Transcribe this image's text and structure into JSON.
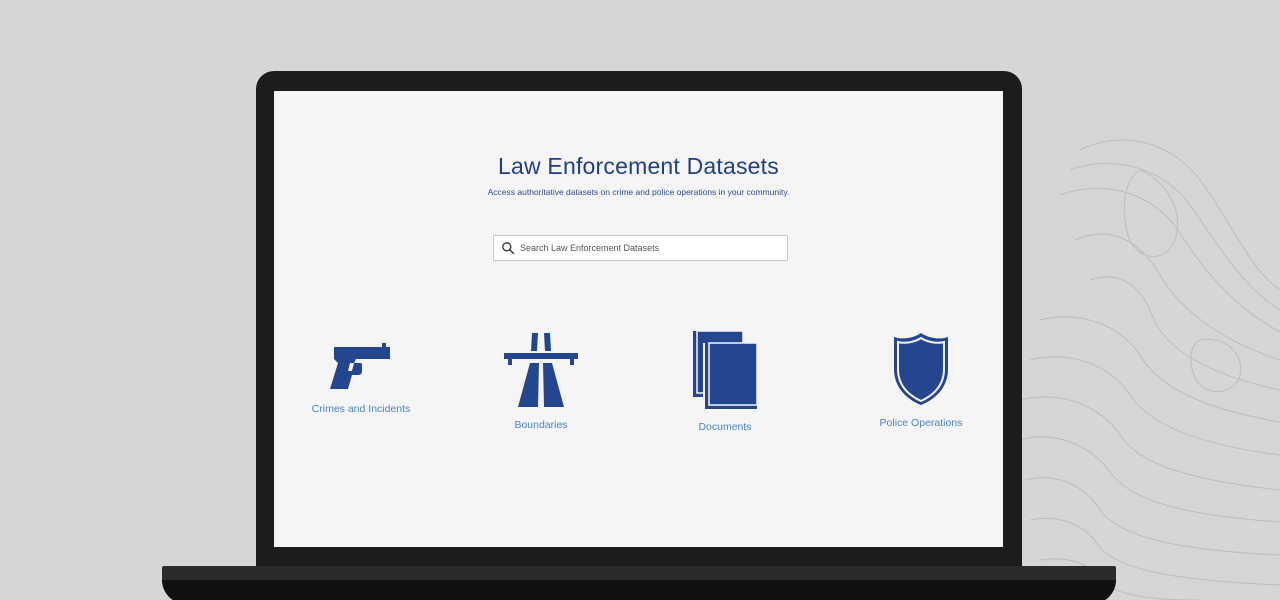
{
  "hub": {
    "title": "Law Enforcement Datasets",
    "subtitle": "Access authoritative datasets on crime and police operations in your community."
  },
  "search": {
    "placeholder": "Search Law Enforcement Datasets",
    "icon": "search-icon"
  },
  "categories": [
    {
      "label": "Crimes and Incidents",
      "icon": "gun-icon"
    },
    {
      "label": "Boundaries",
      "icon": "highway-icon"
    },
    {
      "label": "Documents",
      "icon": "books-icon"
    },
    {
      "label": "Police Operations",
      "icon": "police-badge-icon"
    }
  ],
  "colors": {
    "primary": "#1f3f84",
    "icon_fill": "#24468f",
    "link": "#4a84c9",
    "screen_bg": "#f5f5f5",
    "backdrop": "#d6d6d6",
    "laptop": "#1c1c1c"
  }
}
